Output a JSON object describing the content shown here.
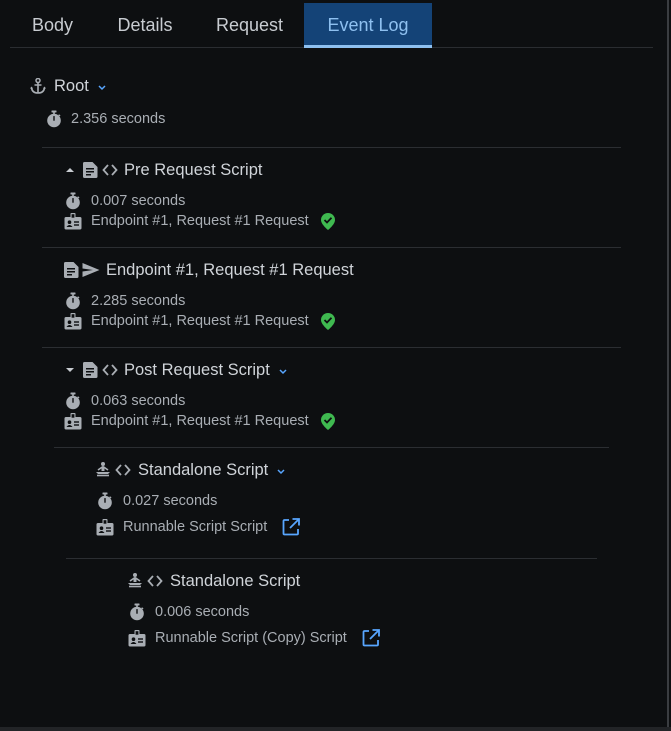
{
  "tabs": [
    {
      "label": "Body",
      "active": false
    },
    {
      "label": "Details",
      "active": false
    },
    {
      "label": "Request",
      "active": false
    },
    {
      "label": "Event Log",
      "active": true
    }
  ],
  "colors": {
    "accent": "#8ec0f0",
    "tab_active_bg": "#144377",
    "success": "#3fb950",
    "link": "#58a6ff"
  },
  "root": {
    "icon": "anchor-icon",
    "title": "Root",
    "duration": "2.356 seconds",
    "expanded": true
  },
  "events": [
    {
      "title": "Pre Request Script",
      "icons": [
        "caret-up-icon",
        "document-icon",
        "code-icon"
      ],
      "duration": "0.007 seconds",
      "source": "Endpoint #1, Request #1 Request",
      "status_icon": "success-check-icon"
    },
    {
      "title": "Endpoint #1, Request #1 Request",
      "icons": [
        "document-icon",
        "send-icon"
      ],
      "duration": "2.285 seconds",
      "source": "Endpoint #1, Request #1 Request",
      "status_icon": "success-check-icon"
    },
    {
      "title": "Post Request Script",
      "icons": [
        "caret-down-icon",
        "document-icon",
        "code-icon"
      ],
      "duration": "0.063 seconds",
      "source": "Endpoint #1, Request #1 Request",
      "status_icon": "success-check-icon",
      "expanded": true
    },
    {
      "title": "Standalone Script",
      "icons": [
        "meditation-icon",
        "code-icon"
      ],
      "duration": "0.027 seconds",
      "source": "Runnable Script Script",
      "status_icon": "open-external-icon",
      "expanded": true
    },
    {
      "title": "Standalone Script",
      "icons": [
        "meditation-icon",
        "code-icon"
      ],
      "duration": "0.006 seconds",
      "source": "Runnable Script (Copy) Script",
      "status_icon": "open-external-icon"
    }
  ]
}
